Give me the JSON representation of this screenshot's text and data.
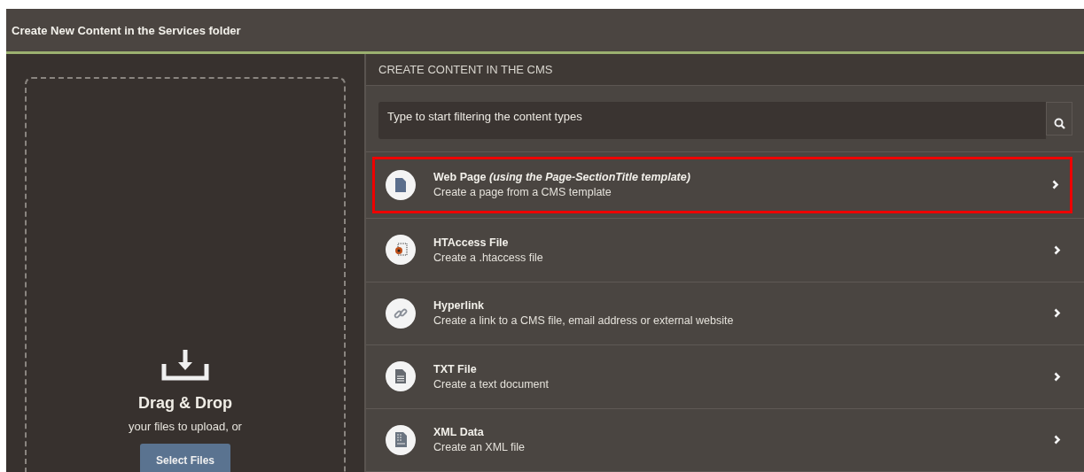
{
  "window": {
    "title": "Create New Content in the Services folder"
  },
  "upload": {
    "heading": "Drag & Drop",
    "text": "your files to upload, or",
    "button": "Select Files"
  },
  "content": {
    "heading": "CREATE CONTENT IN THE CMS",
    "search": {
      "placeholder": "Type to start filtering the content types"
    },
    "items": [
      {
        "kind": "page",
        "title": "Web Page *(using the Page-SectionTitle template)*",
        "description": "Create a page from a CMS template",
        "selected": true
      },
      {
        "kind": "htaccess",
        "title": "HTAccess File",
        "description": "Create a .htaccess file",
        "selected": false
      },
      {
        "kind": "link",
        "title": "Hyperlink",
        "description": "Create a link to a CMS file, email address or external website",
        "selected": false
      },
      {
        "kind": "text",
        "title": "TXT File",
        "description": "Create a text document",
        "selected": false
      },
      {
        "kind": "xml",
        "title": "XML Data",
        "description": "Create an XML file",
        "selected": false
      }
    ]
  }
}
